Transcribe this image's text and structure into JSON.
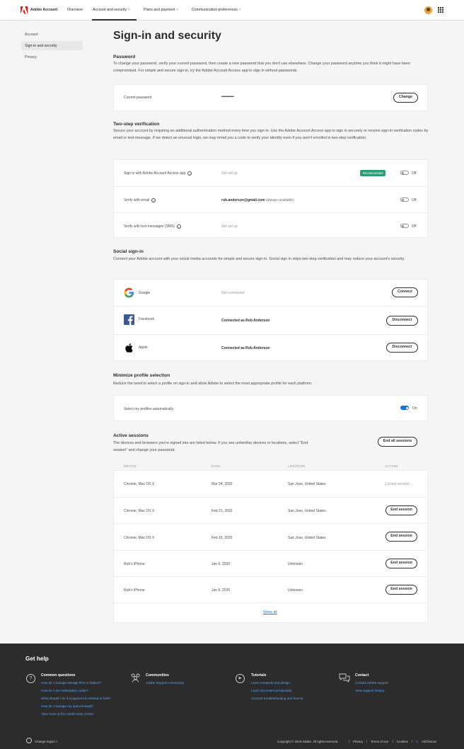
{
  "header": {
    "brand": "Adobe Account",
    "nav": [
      {
        "label": "Overview"
      },
      {
        "label": "Account and security",
        "chevron": "˅"
      },
      {
        "label": "Plans and payment",
        "chevron": "˅"
      },
      {
        "label": "Communication preferences",
        "chevron": "˅"
      }
    ]
  },
  "sidebar": {
    "items": [
      {
        "label": "Account"
      },
      {
        "label": "Sign-in and security"
      },
      {
        "label": "Privacy"
      }
    ]
  },
  "page_title": "Sign-in and security",
  "password": {
    "title": "Password",
    "description": "To change your password, verify your current password, then create a new password that you don't use elsewhere. Change your password anytime you think it might have been compromised. For simple and secure sign-in, try the Adobe Account Access app to sign in without passwords.",
    "label": "Current password",
    "value": "••••••••••••••",
    "button": "Change"
  },
  "two_step": {
    "title": "Two-step verification",
    "description": "Secure your account by requiring an additional authentication method every time you sign-in. Use the Adobe Account Access app to sign in securely or receive sign-in verification codes by email or text message. If we detect an unusual login, we may email you a code to verify your identity even if you aren't enrolled in two-step verification.",
    "rows": [
      {
        "label": "Sign in with Adobe Account Access app",
        "value": "Not set up",
        "badge": "Recommended",
        "toggle": "Off"
      },
      {
        "label": "Verify with email",
        "value": "rob.anderson@gmail.com",
        "value_suffix": "(always available)",
        "toggle": "Off"
      },
      {
        "label": "Verify with text messages (SMS)",
        "value": "Not set up",
        "toggle": "Off"
      }
    ]
  },
  "social": {
    "title": "Social sign-in",
    "description": "Connect your Adobe account with your social media accounts for simple and secure sign-in. Social sign in skips two-step verification and may reduce your account's security.",
    "rows": [
      {
        "icon": "google-icon",
        "label": "Google",
        "value": "Not connected",
        "button": "Connect"
      },
      {
        "icon": "facebook-icon",
        "label": "Facebook",
        "value": "Connected as Rob Anderson",
        "button": "Disconnect"
      },
      {
        "icon": "apple-icon",
        "label": "Apple",
        "value": "Connected as Rob Anderson",
        "button": "Disconnect"
      }
    ]
  },
  "profile": {
    "title": "Minimize profile selection",
    "description": "Reduce the need to select a profile on sign-in and allow Adobe to select the most appropriate profile for each platform.",
    "label": "Select my profiles automatically.",
    "toggle": "On"
  },
  "sessions": {
    "title": "Active sessions",
    "description": "The devices and browsers you're signed into are listed below. If you see unfamiliar devices or locations, select \"End session\" and change your password.",
    "end_all": "End all sessions",
    "columns": [
      "DEVICE",
      "DATE",
      "LOCATION",
      "ACTION"
    ],
    "rows": [
      {
        "device": "Chrome, Mac OS X",
        "date": "Mar 24, 2020",
        "location": "San Jose, United States",
        "action": "Current session"
      },
      {
        "device": "Chrome, Mac OS X",
        "date": "Feb 21, 2020",
        "location": "San Jose, United States",
        "action": "End session"
      },
      {
        "device": "Chrome, Mac OS X",
        "date": "Feb 15, 2020",
        "location": "San Jose, United States",
        "action": "End session"
      },
      {
        "device": "Rob's iPhone",
        "date": "Jan 6, 2020",
        "location": "Unknown",
        "action": "End session"
      },
      {
        "device": "Rob's iPhone",
        "date": "Jan 6, 2020",
        "location": "Unknown",
        "action": "End session"
      }
    ],
    "show_all": "Show all"
  },
  "footer": {
    "title": "Get help",
    "columns": [
      {
        "icon": "question-icon",
        "title": "Common questions",
        "links": [
          "How do I manage storage files or folders?",
          "How do I use redemption codes?",
          "What should I do if a payment is missed or fails?",
          "How do I manage my auto-renewal?",
          "View more at the Adobe Help Center"
        ]
      },
      {
        "icon": "community-icon",
        "title": "Communities",
        "links": [
          "Adobe Support community"
        ]
      },
      {
        "icon": "play-icon",
        "title": "Tutorials",
        "links": [
          "Learn creativity and design",
          "Learn document productivity",
          "Account troubleshooting and how-to"
        ]
      },
      {
        "icon": "chat-icon",
        "title": "Contact",
        "links": [
          "Contact Adobe support",
          "View support history"
        ]
      }
    ],
    "region": "Change region",
    "copyright": "Copyright © 2019 Adobe. All rights reserved.",
    "legal_links": [
      "Privacy",
      "Terms of use",
      "Cookies",
      "AdChoices"
    ]
  },
  "colors": {
    "accent": "#1473e6",
    "brand_red": "#fa0f00",
    "recommended": "#2d9d78",
    "footer_bg": "#2c2c2c"
  }
}
